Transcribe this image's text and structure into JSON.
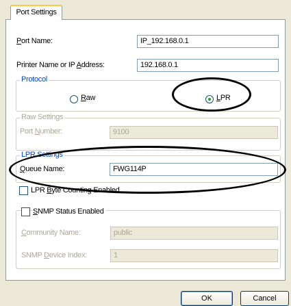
{
  "tab": {
    "label": "Port Settings"
  },
  "port_name": {
    "label_u": "P",
    "label_rest": "ort Name:",
    "value": "IP_192.168.0.1"
  },
  "printer_address": {
    "label_pre": "Printer Name or IP ",
    "label_u": "A",
    "label_rest": "ddress:",
    "value": "192.168.0.1"
  },
  "protocol": {
    "legend": "Protocol",
    "raw_u": "R",
    "raw_rest": "aw",
    "lpr_u": "L",
    "lpr_rest": "PR",
    "selected": "LPR"
  },
  "raw_settings": {
    "legend": "Raw Settings",
    "port_number_pre": "Port ",
    "port_number_u": "N",
    "port_number_rest": "umber:",
    "port_number_value": "9100"
  },
  "lpr_settings": {
    "legend": "LPR Settings",
    "queue_u": "Q",
    "queue_rest": "ueue Name:",
    "queue_value": "FWG114P",
    "byte_counting_pre": "LPR ",
    "byte_counting_u": "B",
    "byte_counting_rest": "yte Counting Enabled",
    "byte_counting_checked": false
  },
  "snmp": {
    "u": "S",
    "rest": "NMP Status Enabled",
    "checked": false,
    "community_u": "C",
    "community_rest": "ommunity Name:",
    "community_value": "public",
    "device_index_pre": "SNMP ",
    "device_index_u": "D",
    "device_index_rest": "evice Index:",
    "device_index_value": "1"
  },
  "buttons": {
    "ok": "OK",
    "cancel": "Cancel"
  },
  "colors": {
    "accent": "#0046d5",
    "tab_highlight": "#ffc83c",
    "radio_selected": "#21a121",
    "annotation": "#000000"
  }
}
